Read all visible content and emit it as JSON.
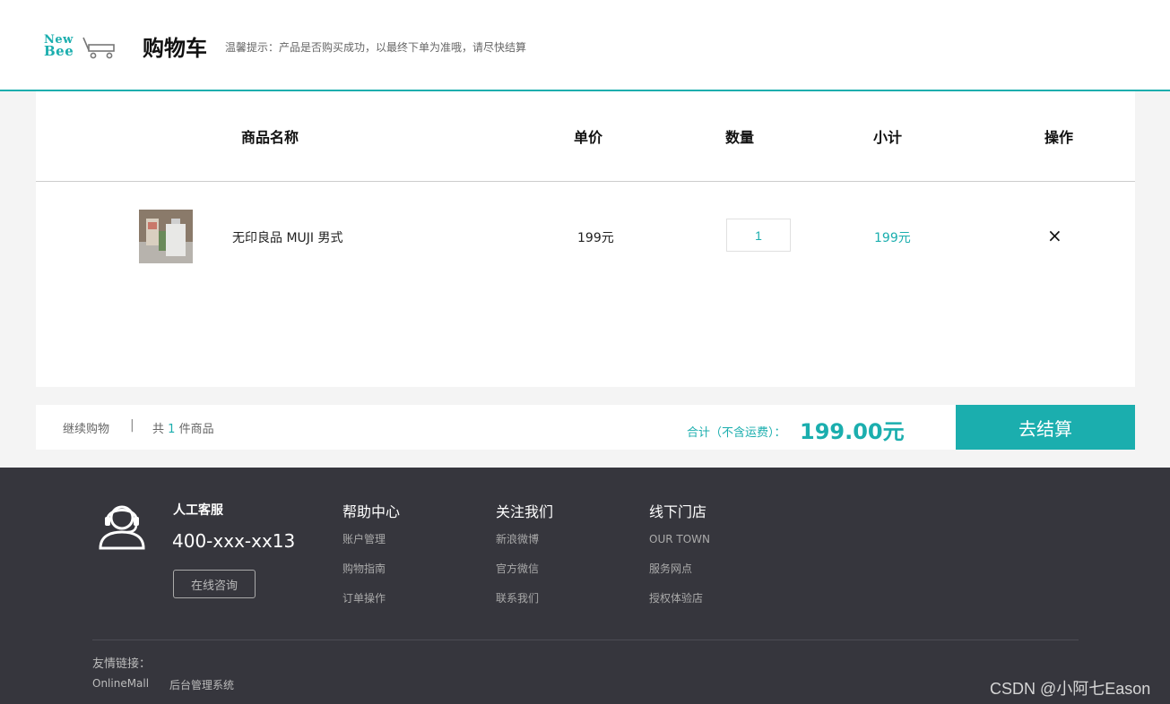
{
  "header": {
    "logo_line1": "New",
    "logo_line2": "Bee",
    "title": "购物车",
    "tip": "温馨提示：产品是否购买成功，以最终下单为准哦，请尽快结算"
  },
  "table": {
    "headers": [
      "商品名称",
      "单价",
      "数量",
      "小计",
      "操作"
    ]
  },
  "items": [
    {
      "name": "无印良品 MUJI 男式",
      "price": "199元",
      "quantity": "1",
      "subtotal": "199元",
      "remove_icon": "×"
    }
  ],
  "summary": {
    "continue": "继续购物",
    "separator": "|",
    "count_prefix": "共",
    "count": "1",
    "count_suffix": "件商品",
    "total_label": "合计（不含运费）：",
    "total_amount": "199.00元",
    "checkout_label": "去结算"
  },
  "footer": {
    "service_title": "人工客服",
    "service_phone": "400-xxx-xx13",
    "consult_label": "在线咨询",
    "columns": [
      {
        "title": "帮助中心",
        "links": [
          "账户管理",
          "购物指南",
          "订单操作"
        ]
      },
      {
        "title": "关注我们",
        "links": [
          "新浪微博",
          "官方微信",
          "联系我们"
        ]
      },
      {
        "title": "线下门店",
        "links": [
          "OUR TOWN",
          "服务网点",
          "授权体验店"
        ]
      }
    ],
    "friend_label": "友情链接：",
    "friend_links": [
      "OnlineMall",
      "后台管理系统"
    ]
  },
  "watermark": "CSDN @小阿七Eason",
  "colors": {
    "accent": "#1baeae",
    "footer_bg": "#36363d",
    "page_bg": "#f4f4f4"
  }
}
